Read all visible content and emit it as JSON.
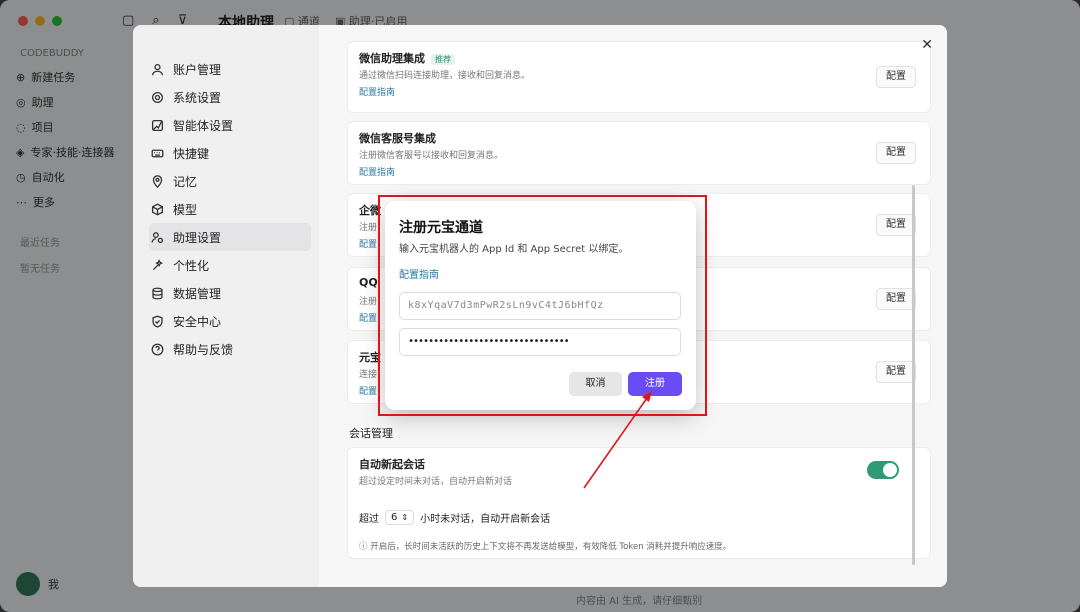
{
  "app": {
    "title": "本地助理",
    "title_tag1": "▢ 通道",
    "title_tag2": "▣ 助理·已启用",
    "sidebar_brand": "CODEBUDDY",
    "nav": [
      {
        "icon": "new-task-icon",
        "label": "新建任务"
      },
      {
        "icon": "assistant-icon",
        "label": "助理"
      },
      {
        "icon": "project-icon",
        "label": "项目"
      },
      {
        "icon": "expert-icon",
        "label": "专家·技能·连接器"
      },
      {
        "icon": "automation-icon",
        "label": "自动化"
      },
      {
        "icon": "more-icon",
        "label": "更多"
      }
    ],
    "section1": "最近任务",
    "section2": "暂无任务",
    "user": "我",
    "footer": "内容由 AI 生成，请仔细甄别"
  },
  "settings": {
    "close": "✕",
    "nav": [
      {
        "icon": "user-icon",
        "label": "账户管理",
        "active": false
      },
      {
        "icon": "gear-icon",
        "label": "系统设置",
        "active": false
      },
      {
        "icon": "agent-icon",
        "label": "智能体设置",
        "active": false
      },
      {
        "icon": "keyboard-icon",
        "label": "快捷键",
        "active": false
      },
      {
        "icon": "memory-icon",
        "label": "记忆",
        "active": false
      },
      {
        "icon": "cube-icon",
        "label": "模型",
        "active": false
      },
      {
        "icon": "assistant-settings-icon",
        "label": "助理设置",
        "active": true
      },
      {
        "icon": "personalize-icon",
        "label": "个性化",
        "active": false
      },
      {
        "icon": "database-icon",
        "label": "数据管理",
        "active": false
      },
      {
        "icon": "shield-icon",
        "label": "安全中心",
        "active": false
      },
      {
        "icon": "help-icon",
        "label": "帮助与反馈",
        "active": false
      }
    ],
    "cards": [
      {
        "title": "微信助理集成",
        "badge": "推荐",
        "desc": "通过微信扫码连接助理，接收和回复消息。",
        "link": "配置指南",
        "button": "配置"
      },
      {
        "title": "微信客服号集成",
        "badge": "",
        "desc": "注册微信客服号以接收和回复消息。",
        "link": "配置指南",
        "button": "配置"
      },
      {
        "title": "企微",
        "badge": "",
        "desc": "注册",
        "link": "配置",
        "button": "配置"
      },
      {
        "title": "QQ",
        "badge": "",
        "desc": "注册",
        "link": "配置",
        "button": "配置"
      },
      {
        "title": "元宝",
        "badge": "",
        "desc": "连接",
        "link": "配置",
        "button": "配置"
      }
    ],
    "session_section": "会话管理",
    "auto_new": {
      "title": "自动新起会话",
      "desc": "超过设定时间未对话，自动开启新对话",
      "toggle_on": true,
      "prefix": "超过",
      "hours": "6",
      "suffix": "小时未对话，自动开启新会话",
      "note": "ⓘ 开启后，长时间未活跃的历史上下文将不再发送给模型，有效降低 Token 消耗并提升响应速度。"
    }
  },
  "dialog": {
    "title": "注册元宝通道",
    "desc": "输入元宝机器人的 App Id 和 App Secret 以绑定。",
    "link": "配置指南",
    "app_id_value": "k8xYqaV7d3mPwR2sLn9vC4tJ6bHfQz",
    "app_secret_value": "••••••••••••••••••••••••••••••••",
    "cancel": "取消",
    "register": "注册"
  },
  "colors": {
    "accent": "#6a4cf5",
    "toggle": "#2f9a76",
    "annotation": "#e0141b",
    "link": "#2a7aa8"
  }
}
